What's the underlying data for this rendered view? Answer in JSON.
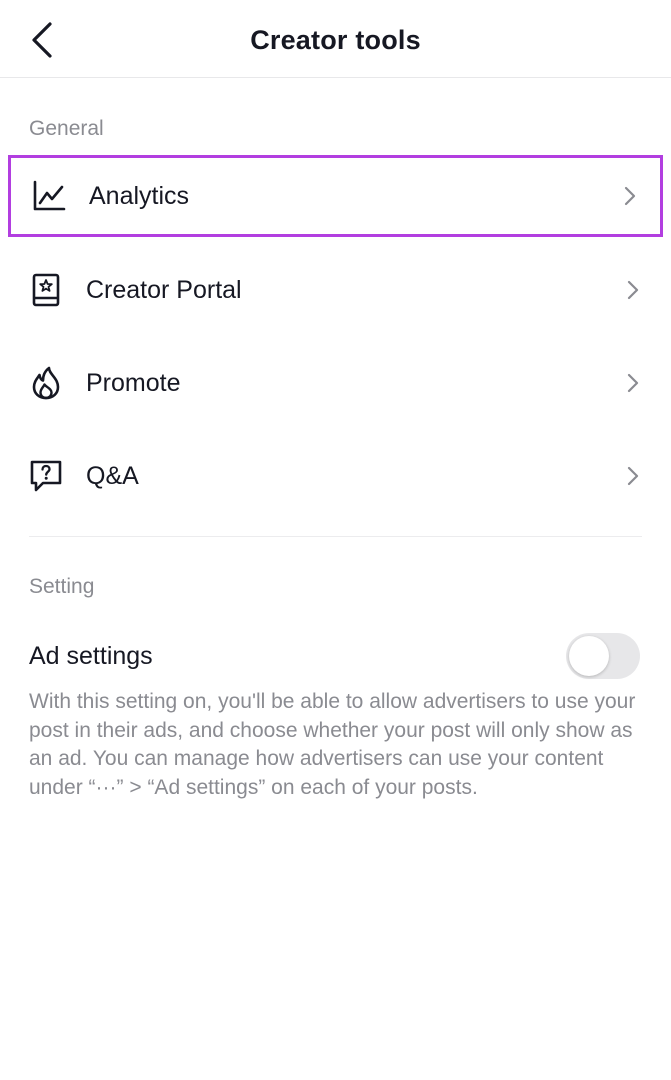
{
  "header": {
    "title": "Creator tools",
    "back_icon": "chevron-left-icon"
  },
  "general": {
    "label": "General",
    "items": [
      {
        "label": "Analytics",
        "icon": "analytics-chart-icon",
        "highlighted": true
      },
      {
        "label": "Creator Portal",
        "icon": "creator-portal-book-icon"
      },
      {
        "label": "Promote",
        "icon": "flame-icon"
      },
      {
        "label": "Q&A",
        "icon": "question-bubble-icon"
      }
    ]
  },
  "setting": {
    "label": "Setting",
    "ad_settings": {
      "title": "Ad settings",
      "toggle_on": false,
      "description": "With this setting on, you'll be able to allow advertisers to use your post in their ads, and choose whether your post will only show as an ad. You can manage how advertisers can use your content under “···” > “Ad settings” on each of your posts."
    }
  },
  "colors": {
    "highlight_border": "#b23ee0",
    "text_primary": "#161823",
    "text_secondary": "#8a8b91",
    "toggle_off": "#e7e7e9"
  }
}
